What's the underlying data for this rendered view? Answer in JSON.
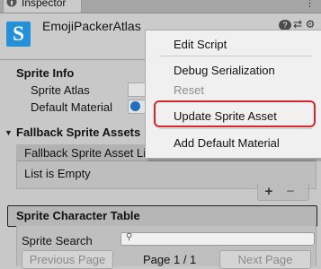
{
  "tab": {
    "label": "Inspector",
    "icon": "info-icon"
  },
  "header": {
    "asset_icon": "S",
    "asset_name": "EmojiPackerAtlas",
    "icons": [
      "help-icon",
      "sliders-icon",
      "gear-icon"
    ]
  },
  "sprite_info": {
    "title": "Sprite Info",
    "fields": [
      {
        "label": "Sprite Atlas"
      },
      {
        "label": "Default Material"
      }
    ]
  },
  "fallback": {
    "title": "Fallback Sprite Assets",
    "list_header": "Fallback Sprite Asset List",
    "empty_text": "List is Empty",
    "add": "+",
    "remove": "−"
  },
  "character_table": {
    "title": "Sprite Character Table",
    "search_label": "Sprite Search",
    "prev": "Previous Page",
    "page": "Page 1 / 1",
    "next": "Next Page"
  },
  "context_menu": {
    "items": [
      {
        "label": "Edit Script",
        "enabled": true
      },
      {
        "label": "Debug Serialization",
        "enabled": true
      },
      {
        "label": "Reset",
        "enabled": false
      },
      {
        "label": "Update Sprite Asset",
        "enabled": true,
        "highlighted": true
      },
      {
        "label": "Add Default Material",
        "enabled": true
      }
    ]
  },
  "colors": {
    "highlight": "#d6282b",
    "asset_icon_bg": "#2490d8"
  }
}
